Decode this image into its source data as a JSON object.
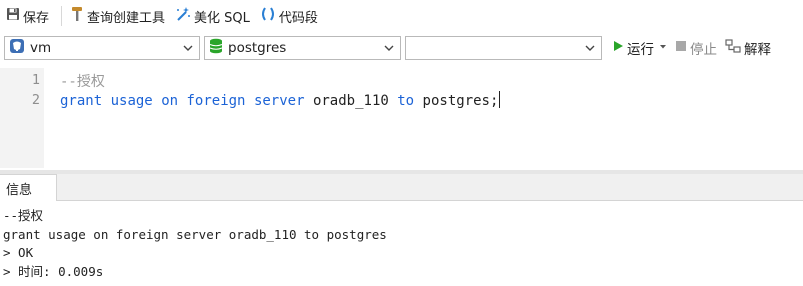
{
  "toolbar": {
    "save_label": "保存",
    "query_builder_label": "查询创建工具",
    "beautify_label": "美化 SQL",
    "snippet_label": "代码段"
  },
  "selectors": {
    "connection": "vm",
    "database": "postgres",
    "schema": ""
  },
  "runbar": {
    "run_label": "运行",
    "stop_label": "停止",
    "explain_label": "解释"
  },
  "editor": {
    "line_numbers": [
      "1",
      "2"
    ],
    "line1_comment": "--授权",
    "line2": {
      "kw1": "grant",
      "kw2": "usage",
      "kw3": "on",
      "kw4": "foreign",
      "kw5": "server",
      "id1": "oradb_110",
      "kw6": "to",
      "id2": "postgres;"
    }
  },
  "result": {
    "tab_label": "信息",
    "lines": [
      "--授权",
      "grant usage on foreign server oradb_110 to postgres",
      "> OK",
      "> 时间: 0.009s"
    ]
  },
  "colors": {
    "keyword": "#1c63d6",
    "comment": "#9a9a9a",
    "run_green": "#2aa52a"
  }
}
